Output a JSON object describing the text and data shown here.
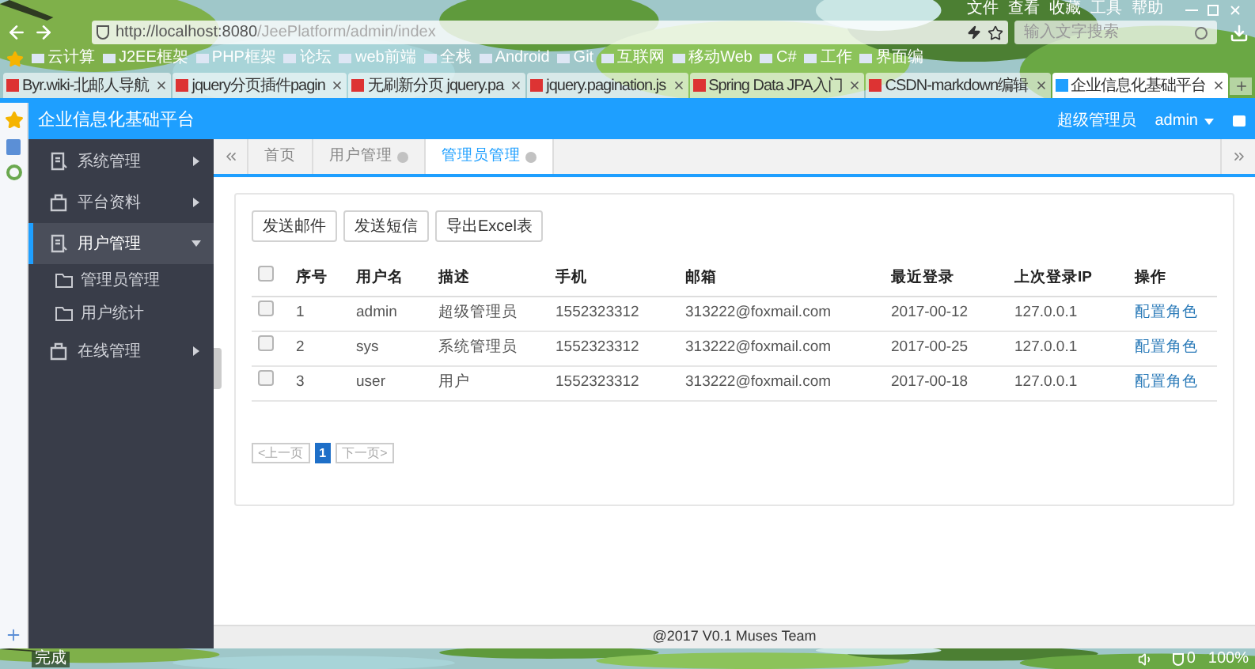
{
  "browser": {
    "menu": [
      "文件",
      "查看",
      "收藏",
      "工具",
      "帮助"
    ],
    "url_host": "http://localhost:8080",
    "url_path": "/JeePlatform/admin/index",
    "search": {
      "placeholder": "输入文字搜索"
    },
    "bookmarks": [
      "云计算",
      "J2EE框架",
      "PHP框架",
      "论坛",
      "web前端",
      "全栈",
      "Android",
      "Git",
      "互联网",
      "移动Web",
      "C#",
      "工作",
      "界面编"
    ],
    "tabs": [
      {
        "label": "Byr.wiki-北邮人导航",
        "selected": false
      },
      {
        "label": "jquery分页插件pagin",
        "selected": false
      },
      {
        "label": "无刷新分页 jquery.pa",
        "selected": false
      },
      {
        "label": "jquery.pagination.js",
        "selected": false
      },
      {
        "label": "Spring Data JPA入门",
        "selected": false
      },
      {
        "label": "CSDN-markdown编辑",
        "selected": false
      },
      {
        "label": "企业信息化基础平台",
        "selected": true
      }
    ],
    "status": {
      "text": "完成",
      "count": "0",
      "zoom": "100%"
    }
  },
  "app": {
    "brand": "企业信息化基础平台",
    "role": "超级管理员",
    "user": "admin",
    "sidebar": [
      {
        "label": "系统管理",
        "selected": false,
        "expanded": false
      },
      {
        "label": "平台资料",
        "selected": false,
        "expanded": false
      },
      {
        "label": "用户管理",
        "selected": true,
        "expanded": true,
        "children": [
          {
            "label": "管理员管理"
          },
          {
            "label": "用户统计"
          }
        ]
      },
      {
        "label": "在线管理",
        "selected": false,
        "expanded": false
      }
    ],
    "page_tabs": [
      {
        "label": "首页",
        "selected": false,
        "closable": false
      },
      {
        "label": "用户管理",
        "selected": false,
        "closable": true
      },
      {
        "label": "管理员管理",
        "selected": true,
        "closable": true
      }
    ],
    "actions": [
      "发送邮件",
      "发送短信",
      "导出Excel表"
    ],
    "table": {
      "columns": [
        "序号",
        "用户名",
        "描述",
        "手机",
        "邮箱",
        "最近登录",
        "上次登录IP",
        "操作"
      ],
      "header_checked": false,
      "rows": [
        {
          "checked": false,
          "cells": [
            "1",
            "admin",
            "超级管理员",
            "1552323312",
            "313222@foxmail.com",
            "2017-00-12",
            "127.0.0.1"
          ],
          "action": "配置角色"
        },
        {
          "checked": false,
          "cells": [
            "2",
            "sys",
            "系统管理员",
            "1552323312",
            "313222@foxmail.com",
            "2017-00-25",
            "127.0.0.1"
          ],
          "action": "配置角色"
        },
        {
          "checked": false,
          "cells": [
            "3",
            "user",
            "用户",
            "1552323312",
            "313222@foxmail.com",
            "2017-00-18",
            "127.0.0.1"
          ],
          "action": "配置角色"
        }
      ]
    },
    "pagination": {
      "prev": "<上一页",
      "pages": [
        {
          "label": "1",
          "selected": true
        }
      ],
      "next": "下一页>"
    },
    "footer": "@2017 V0.1 Muses Team"
  }
}
